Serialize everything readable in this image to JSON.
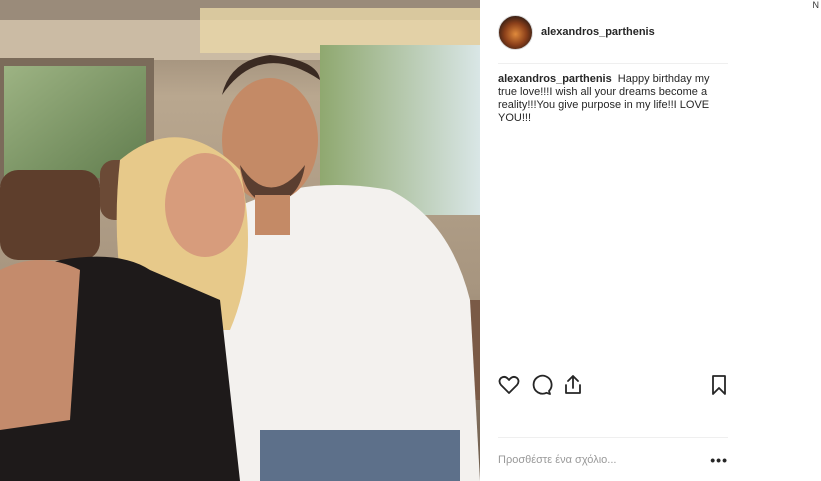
{
  "post": {
    "username": "alexandros_parthenis",
    "caption_user": "alexandros_parthenis",
    "caption_text": "Happy birthday my true love!!!I wish all your dreams become a reality!!!You give purpose in my life!!I LOVE YOU!!!",
    "photo_alt": "photo"
  },
  "actions": {
    "like_icon": "heart-icon",
    "comment_icon": "comment-icon",
    "share_icon": "share-icon",
    "save_icon": "bookmark-icon"
  },
  "comment": {
    "placeholder": "Προσθέστε ένα σχόλιο...",
    "more_label": "•••"
  },
  "corner": {
    "mark": "N"
  },
  "colors": {
    "text": "#262626",
    "muted": "#999999",
    "divider": "#efefef"
  }
}
